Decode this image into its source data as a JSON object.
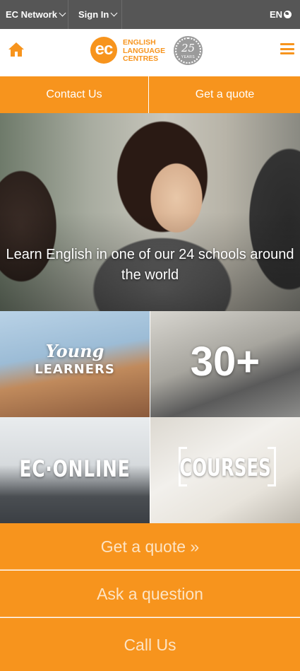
{
  "topbar": {
    "network_label": "EC Network",
    "signin_label": "Sign In",
    "language_label": "EN",
    "bg_color": "#565656"
  },
  "header": {
    "logo_mark": "ec",
    "logo_text_line1": "ENGLISH",
    "logo_text_line2": "LANGUAGE",
    "logo_text_line3": "CENTRES",
    "anniversary_number": "25",
    "anniversary_label": "YEARS",
    "accent_color": "#f7941d",
    "icons": [
      "home-icon",
      "menu-icon"
    ]
  },
  "actions": {
    "contact_label": "Contact Us",
    "quote_label": "Get a quote"
  },
  "hero": {
    "headline": "Learn English in one of our 24 schools around the world"
  },
  "tiles": {
    "young_learners_line1": "Young",
    "young_learners_line2": "LEARNERS",
    "thirty_plus": "30+",
    "ec_online": "EC·ONLINE",
    "courses": "COURSES"
  },
  "ctas": {
    "quote": "Get a quote »",
    "ask": "Ask a question",
    "call": "Call Us"
  }
}
